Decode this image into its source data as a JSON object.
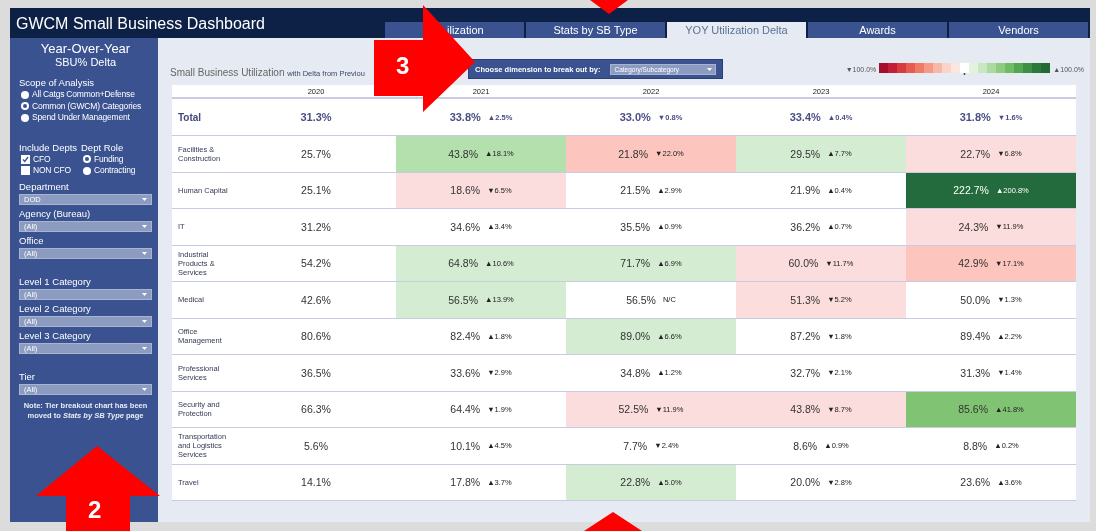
{
  "header": {
    "title": "GWCM Small Business Dashboard"
  },
  "tabs": [
    {
      "label": "ilization",
      "selected": false
    },
    {
      "label": "Stats by SB Type",
      "selected": false
    },
    {
      "label": "YOY Utilization Delta",
      "selected": true
    },
    {
      "label": "Awards",
      "selected": false
    },
    {
      "label": "Vendors",
      "selected": false
    }
  ],
  "sidebar": {
    "heading": "Year-Over-Year",
    "subheading": "SBU% Delta",
    "scope": {
      "label": "Scope of Analysis",
      "options": [
        {
          "label": "All Catgs Common+Defense",
          "selected": false
        },
        {
          "label": "Common (GWCM) Categories",
          "selected": true
        },
        {
          "label": "Spend Under Management",
          "selected": false
        }
      ]
    },
    "include_depts": {
      "label": "Include Depts",
      "options": [
        {
          "label": "CFO",
          "checked": true
        },
        {
          "label": "NON CFO",
          "checked": false
        }
      ]
    },
    "dept_role": {
      "label": "Dept Role",
      "options": [
        {
          "label": "Funding",
          "selected": true
        },
        {
          "label": "Contracting",
          "selected": false
        }
      ]
    },
    "filter_groups": [
      {
        "filters": [
          {
            "label": "Department",
            "value": "DOD"
          },
          {
            "label": "Agency (Bureau)",
            "value": "(All)"
          },
          {
            "label": "Office",
            "value": "(All)"
          }
        ]
      },
      {
        "filters": [
          {
            "label": "Level 1 Category",
            "value": "(All)"
          },
          {
            "label": "Level 2 Category",
            "value": "(All)"
          },
          {
            "label": "Level 3 Category",
            "value": "(All)"
          }
        ]
      },
      {
        "filters": [
          {
            "label": "Tier",
            "value": "(All)"
          }
        ]
      }
    ],
    "note": "Note: Tier breakout chart has been moved to *Stats by SB Type* page"
  },
  "main": {
    "title": "Small Business Utilization",
    "subtitle": "with Delta from Previou",
    "dimension": {
      "label": "Choose dimension to break out by:",
      "value": "Category/Subcategory"
    },
    "legend": {
      "low": "▼100.0%",
      "high": "▲100.0%"
    },
    "table": {
      "columns": [
        "2020",
        "2021",
        "2022",
        "2023",
        "2024"
      ],
      "rows": [
        {
          "label": "Total",
          "total": true,
          "cells": [
            {
              "value": "31.3%",
              "color": "#ffffff"
            },
            {
              "value": "33.8%",
              "delta": "▲2.5%",
              "color": "#ffffff"
            },
            {
              "value": "33.0%",
              "delta": "▼0.8%",
              "color": "#ffffff"
            },
            {
              "value": "33.4%",
              "delta": "▲0.4%",
              "color": "#ffffff"
            },
            {
              "value": "31.8%",
              "delta": "▼1.6%",
              "color": "#ffffff"
            }
          ]
        },
        {
          "label": "Facilities & Construction",
          "total": false,
          "cells": [
            {
              "value": "25.7%",
              "color": "#ffffff"
            },
            {
              "value": "43.8%",
              "delta": "▲18.1%",
              "color": "#b4e0ad"
            },
            {
              "value": "21.8%",
              "delta": "▼22.0%",
              "color": "#fcc5bd"
            },
            {
              "value": "29.5%",
              "delta": "▲7.7%",
              "color": "#d4ecd2"
            },
            {
              "value": "22.7%",
              "delta": "▼6.8%",
              "color": "#fcdddd"
            }
          ]
        },
        {
          "label": "Human Capital",
          "total": false,
          "cells": [
            {
              "value": "25.1%",
              "color": "#ffffff"
            },
            {
              "value": "18.6%",
              "delta": "▼6.5%",
              "color": "#fcdddd"
            },
            {
              "value": "21.5%",
              "delta": "▲2.9%",
              "color": "#ffffff"
            },
            {
              "value": "21.9%",
              "delta": "▲0.4%",
              "color": "#ffffff"
            },
            {
              "value": "222.7%",
              "delta": "▲200.8%",
              "color": "#236a3d"
            }
          ]
        },
        {
          "label": "IT",
          "total": false,
          "cells": [
            {
              "value": "31.2%",
              "color": "#ffffff"
            },
            {
              "value": "34.6%",
              "delta": "▲3.4%",
              "color": "#ffffff"
            },
            {
              "value": "35.5%",
              "delta": "▲0.9%",
              "color": "#ffffff"
            },
            {
              "value": "36.2%",
              "delta": "▲0.7%",
              "color": "#ffffff"
            },
            {
              "value": "24.3%",
              "delta": "▼11.9%",
              "color": "#fcdddd"
            }
          ]
        },
        {
          "label": "Industrial Products & Services",
          "total": false,
          "cells": [
            {
              "value": "54.2%",
              "color": "#ffffff"
            },
            {
              "value": "64.8%",
              "delta": "▲10.6%",
              "color": "#d4ecd2"
            },
            {
              "value": "71.7%",
              "delta": "▲6.9%",
              "color": "#d4ecd2"
            },
            {
              "value": "60.0%",
              "delta": "▼11.7%",
              "color": "#fcdddd"
            },
            {
              "value": "42.9%",
              "delta": "▼17.1%",
              "color": "#fcc5bd"
            }
          ]
        },
        {
          "label": "Medical",
          "total": false,
          "cells": [
            {
              "value": "42.6%",
              "color": "#ffffff"
            },
            {
              "value": "56.5%",
              "delta": "▲13.9%",
              "color": "#d4ecd2"
            },
            {
              "value": "56.5%",
              "delta": "N/C",
              "color": "#ffffff"
            },
            {
              "value": "51.3%",
              "delta": "▼5.2%",
              "color": "#fcdddd"
            },
            {
              "value": "50.0%",
              "delta": "▼1.3%",
              "color": "#ffffff"
            }
          ]
        },
        {
          "label": "Office Management",
          "total": false,
          "cells": [
            {
              "value": "80.6%",
              "color": "#ffffff"
            },
            {
              "value": "82.4%",
              "delta": "▲1.8%",
              "color": "#ffffff"
            },
            {
              "value": "89.0%",
              "delta": "▲6.6%",
              "color": "#d4ecd2"
            },
            {
              "value": "87.2%",
              "delta": "▼1.8%",
              "color": "#ffffff"
            },
            {
              "value": "89.4%",
              "delta": "▲2.2%",
              "color": "#ffffff"
            }
          ]
        },
        {
          "label": "Professional Services",
          "total": false,
          "cells": [
            {
              "value": "36.5%",
              "color": "#ffffff"
            },
            {
              "value": "33.6%",
              "delta": "▼2.9%",
              "color": "#ffffff"
            },
            {
              "value": "34.8%",
              "delta": "▲1.2%",
              "color": "#ffffff"
            },
            {
              "value": "32.7%",
              "delta": "▼2.1%",
              "color": "#ffffff"
            },
            {
              "value": "31.3%",
              "delta": "▼1.4%",
              "color": "#ffffff"
            }
          ]
        },
        {
          "label": "Security and Protection",
          "total": false,
          "cells": [
            {
              "value": "66.3%",
              "color": "#ffffff"
            },
            {
              "value": "64.4%",
              "delta": "▼1.9%",
              "color": "#ffffff"
            },
            {
              "value": "52.5%",
              "delta": "▼11.9%",
              "color": "#fcdddd"
            },
            {
              "value": "43.8%",
              "delta": "▼8.7%",
              "color": "#fcdddd"
            },
            {
              "value": "85.6%",
              "delta": "▲41.8%",
              "color": "#80c473"
            }
          ]
        },
        {
          "label": "Transportation and Logistics Services",
          "total": false,
          "cells": [
            {
              "value": "5.6%",
              "color": "#ffffff"
            },
            {
              "value": "10.1%",
              "delta": "▲4.5%",
              "color": "#ffffff"
            },
            {
              "value": "7.7%",
              "delta": "▼2.4%",
              "color": "#ffffff"
            },
            {
              "value": "8.6%",
              "delta": "▲0.9%",
              "color": "#ffffff"
            },
            {
              "value": "8.8%",
              "delta": "▲0.2%",
              "color": "#ffffff"
            }
          ]
        },
        {
          "label": "Travel",
          "total": false,
          "cells": [
            {
              "value": "14.1%",
              "color": "#ffffff"
            },
            {
              "value": "17.8%",
              "delta": "▲3.7%",
              "color": "#ffffff"
            },
            {
              "value": "22.8%",
              "delta": "▲5.0%",
              "color": "#d4ecd2"
            },
            {
              "value": "20.0%",
              "delta": "▼2.8%",
              "color": "#ffffff"
            },
            {
              "value": "23.6%",
              "delta": "▲3.6%",
              "color": "#ffffff"
            }
          ]
        }
      ]
    }
  },
  "annotations": [
    {
      "kind": "arrow-right",
      "label": "3"
    },
    {
      "kind": "arrow-up",
      "label": "2"
    },
    {
      "kind": "tip-down"
    },
    {
      "kind": "tip-up"
    }
  ]
}
